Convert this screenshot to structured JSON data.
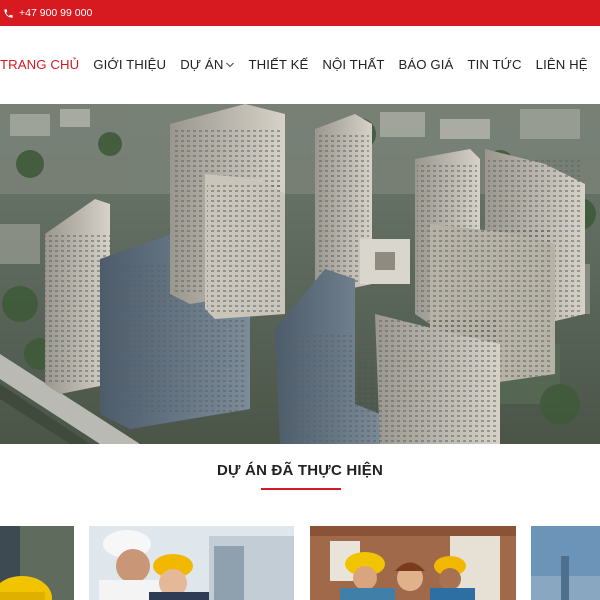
{
  "topbar": {
    "phone": "+47 900 99 000",
    "phone_icon": "phone-icon",
    "background": "#d71920"
  },
  "nav": {
    "items": [
      {
        "label": "TRANG CHỦ",
        "active": true
      },
      {
        "label": "GIỚI THIỆU",
        "active": false
      },
      {
        "label": "DỰ ÁN",
        "active": false,
        "has_dropdown": true
      },
      {
        "label": "THIẾT KẾ",
        "active": false
      },
      {
        "label": "NỘI THẤT",
        "active": false
      },
      {
        "label": "BÁO GIÁ",
        "active": false
      },
      {
        "label": "TIN TỨC",
        "active": false
      },
      {
        "label": "LIÊN HỆ",
        "active": false
      }
    ],
    "active_color": "#d71920"
  },
  "hero": {
    "image": "aerial-city-apartment-towers",
    "slides": 3,
    "active_slide": 1
  },
  "projects": {
    "title": "DỰ ÁN ĐÃ THỰC HIỆN",
    "accent": "#d71920",
    "cards": [
      {
        "image": "worker-yellow-hardhat"
      },
      {
        "image": "engineers-with-hardhats"
      },
      {
        "image": "workers-at-construction-site"
      },
      {
        "image": "sky-building"
      }
    ]
  }
}
